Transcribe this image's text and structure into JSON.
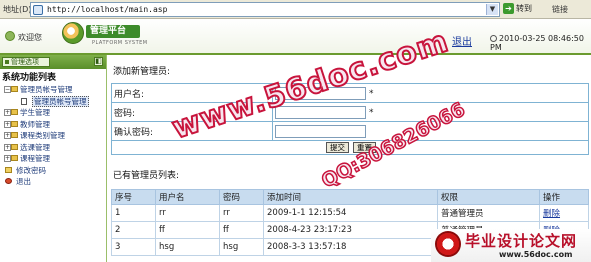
{
  "browser": {
    "address_label": "地址(D)",
    "url": "http://localhost/main.asp",
    "go_label": "转到",
    "links_label": "链接"
  },
  "header": {
    "welcome": "欢迎您",
    "logo_title": "管理平台",
    "logo_subtitle": "PLATFORM SYSTEM",
    "logout": "退出",
    "datetime": "2010-03-25 08:46:50 PM"
  },
  "sidebar": {
    "options_label": "管理选项",
    "collapse_glyph": "◧",
    "root": "系统功能列表",
    "items": [
      {
        "label": "管理员帐号管理",
        "type": "folder"
      },
      {
        "label": "管理员帐号管理",
        "type": "child"
      },
      {
        "label": "学生管理",
        "type": "folder"
      },
      {
        "label": "教师管理",
        "type": "folder"
      },
      {
        "label": "课程类别管理",
        "type": "folder"
      },
      {
        "label": "选课管理",
        "type": "folder"
      },
      {
        "label": "课程管理",
        "type": "folder"
      },
      {
        "label": "修改密码",
        "type": "simple"
      },
      {
        "label": "退出",
        "type": "simple"
      }
    ]
  },
  "form": {
    "title": "添加新管理员:",
    "username_label": "用户名:",
    "password_label": "密码:",
    "confirm_label": "确认密码:",
    "required_mark": "*",
    "submit_label": "提交",
    "reset_label": "重置"
  },
  "list": {
    "title": "已有管理员列表:",
    "columns": [
      "序号",
      "用户名",
      "密码",
      "添加时间",
      "权限",
      "操作"
    ],
    "rows": [
      [
        "1",
        "rr",
        "rr",
        "2009-1-1 12:15:54",
        "普通管理员",
        "删除"
      ],
      [
        "2",
        "ff",
        "ff",
        "2008-4-23 23:17:23",
        "普通管理员",
        "删除"
      ],
      [
        "3",
        "hsg",
        "hsg",
        "2008-3-3 13:57:18",
        "",
        ""
      ]
    ]
  },
  "watermarks": {
    "site": "www.56doc.com",
    "qq": "QQ:306826066",
    "badge_text": "毕业设计论文网",
    "badge_url": "www.56doc.com"
  },
  "colors": {
    "header_accent": "#6b9b2f",
    "sidebar_head": "#5a8f2a",
    "table_header": "#c8dcef",
    "link": "#1a3a9e",
    "watermark": "#c8143c"
  }
}
